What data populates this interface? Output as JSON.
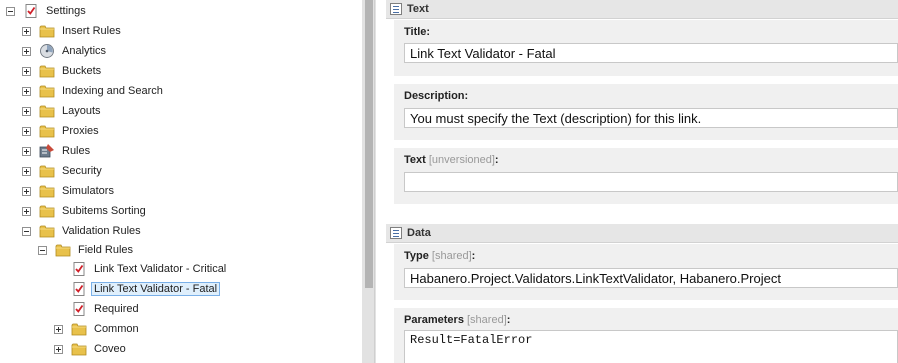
{
  "tree": {
    "root": {
      "label": "Settings",
      "icon": "settings-check-icon"
    },
    "items": [
      {
        "label": "Insert Rules",
        "icon": "folder-icon"
      },
      {
        "label": "Analytics",
        "icon": "analytics-icon"
      },
      {
        "label": "Buckets",
        "icon": "folder-icon"
      },
      {
        "label": "Indexing and Search",
        "icon": "folder-icon"
      },
      {
        "label": "Layouts",
        "icon": "folder-icon"
      },
      {
        "label": "Proxies",
        "icon": "folder-icon"
      },
      {
        "label": "Rules",
        "icon": "rules-icon"
      },
      {
        "label": "Security",
        "icon": "folder-icon"
      },
      {
        "label": "Simulators",
        "icon": "folder-icon"
      },
      {
        "label": "Subitems Sorting",
        "icon": "folder-icon"
      },
      {
        "label": "Validation Rules",
        "icon": "folder-icon"
      }
    ],
    "field_rules": {
      "label": "Field Rules",
      "children": [
        {
          "label": "Link Text Validator - Critical",
          "icon": "validator-icon"
        },
        {
          "label": "Link Text Validator - Fatal",
          "icon": "validator-icon",
          "selected": true
        },
        {
          "label": "Required",
          "icon": "validator-icon"
        }
      ]
    },
    "siblings": [
      {
        "label": "Common",
        "icon": "folder-icon"
      },
      {
        "label": "Coveo",
        "icon": "folder-icon"
      }
    ]
  },
  "editor": {
    "sections": [
      {
        "title": "Text",
        "icon": "section-icon"
      },
      {
        "title": "Data",
        "icon": "section-icon"
      }
    ],
    "fields": {
      "title": {
        "label": "Title:",
        "value": "Link Text Validator - Fatal"
      },
      "description": {
        "label": "Description:",
        "value": "You must specify the Text (description) for this link."
      },
      "text": {
        "label": "Text",
        "meta": "[unversioned]",
        "suffix": ":",
        "value": ""
      },
      "type": {
        "label": "Type",
        "meta": "[shared]",
        "suffix": ":",
        "value": "Habanero.Project.Validators.LinkTextValidator, Habanero.Project"
      },
      "parameters": {
        "label": "Parameters",
        "meta": "[shared]",
        "suffix": ":",
        "value": "Result=FatalError"
      }
    }
  },
  "colors": {
    "folder": "#e8c14b",
    "selection_bg": "#dfeffc",
    "selection_border": "#7ab0e8",
    "section_header": "#e6e6e6",
    "field_bg": "#f0f0f0"
  }
}
